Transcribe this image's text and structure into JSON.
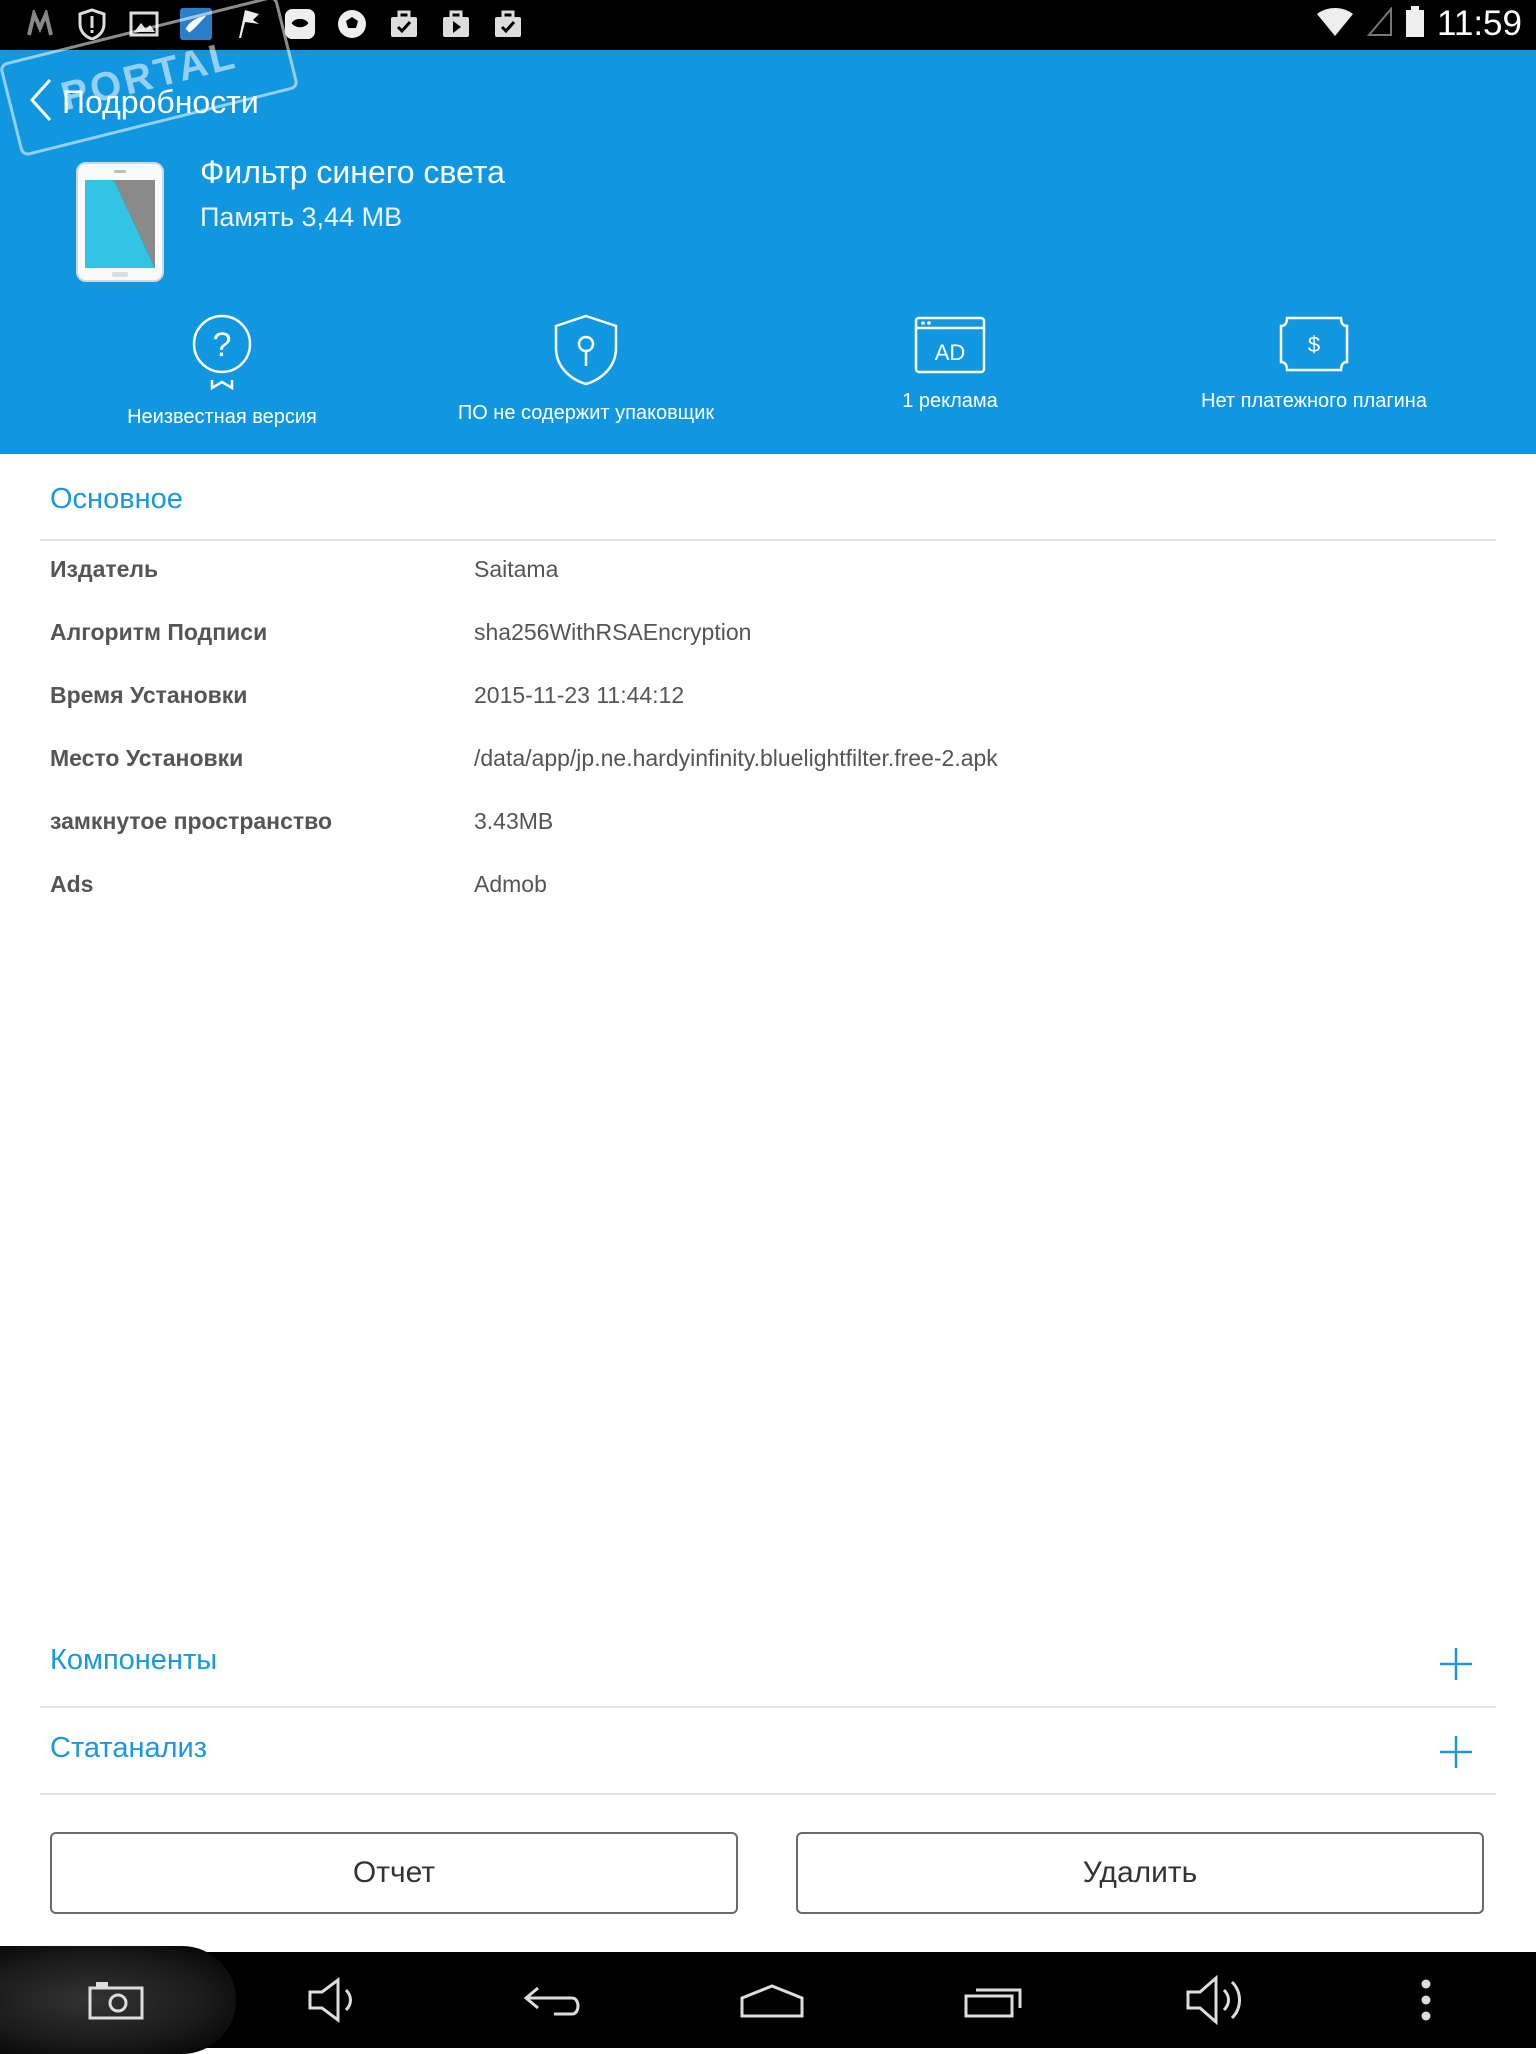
{
  "status_bar": {
    "time": "11:59",
    "icons": [
      "m-icon",
      "shield-alert-icon",
      "image-icon",
      "bird-app-icon",
      "flag-app-icon",
      "face-app-icon",
      "soccer-ball-icon",
      "briefcase-check-icon",
      "briefcase-play-icon",
      "briefcase-check-icon"
    ]
  },
  "header": {
    "title": "Подробности",
    "app_name": "Фильтр синего света",
    "memory": "Память 3,44 MB",
    "watermark": "PORTAL",
    "features": [
      {
        "icon": "question-badge-icon",
        "label": "Неизвестная версия"
      },
      {
        "icon": "shield-icon",
        "label": "ПО не содержит упаковщик"
      },
      {
        "icon": "ad-window-icon",
        "label": "1 реклама"
      },
      {
        "icon": "dollar-bill-icon",
        "label": "Нет платежного плагина"
      }
    ],
    "ad_icon_text": "AD",
    "dollar_icon_text": "$"
  },
  "basic": {
    "title": "Основное",
    "rows": [
      {
        "key": "Издатель",
        "value": "Saitama"
      },
      {
        "key": "Алгоритм Подписи",
        "value": "sha256WithRSAEncryption"
      },
      {
        "key": "Время Установки",
        "value": "2015-11-23 11:44:12"
      },
      {
        "key": "Место Установки",
        "value": "/data/app/jp.ne.hardyinfinity.bluelightfilter.free-2.apk"
      },
      {
        "key": "замкнутое пространство",
        "value": "3.43MB"
      },
      {
        "key": "Ads",
        "value": "Admob"
      }
    ]
  },
  "sections": {
    "components": "Компоненты",
    "stats": "Статанализ"
  },
  "buttons": {
    "report": "Отчет",
    "delete": "Удалить"
  },
  "colors": {
    "header_bg": "#1197e0",
    "accent": "#1a97dd"
  }
}
